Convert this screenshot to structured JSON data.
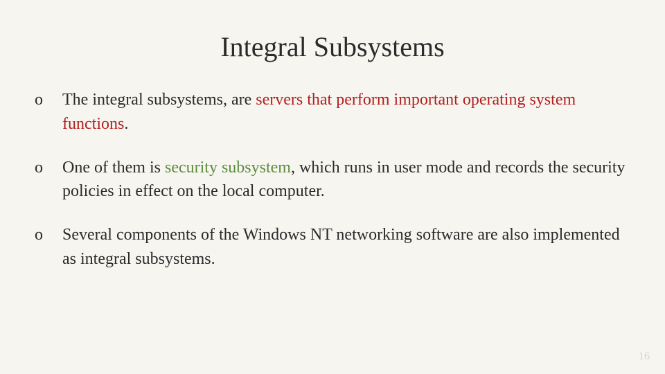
{
  "title": "Integral Subsystems",
  "bullets": [
    {
      "marker": "o",
      "pre": "The integral subsystems, are ",
      "hl": "servers that perform important operating system functions",
      "hl_class": "hl-red",
      "post": "."
    },
    {
      "marker": "o",
      "pre": "One of them is ",
      "hl": "security subsystem",
      "hl_class": "hl-green",
      "post": ", which runs in user mode and records the security policies in effect on the local computer."
    },
    {
      "marker": "o",
      "pre": "Several components of the Windows NT networking software are also implemented as integral subsystems.",
      "hl": "",
      "hl_class": "",
      "post": ""
    }
  ],
  "page_number": "16"
}
